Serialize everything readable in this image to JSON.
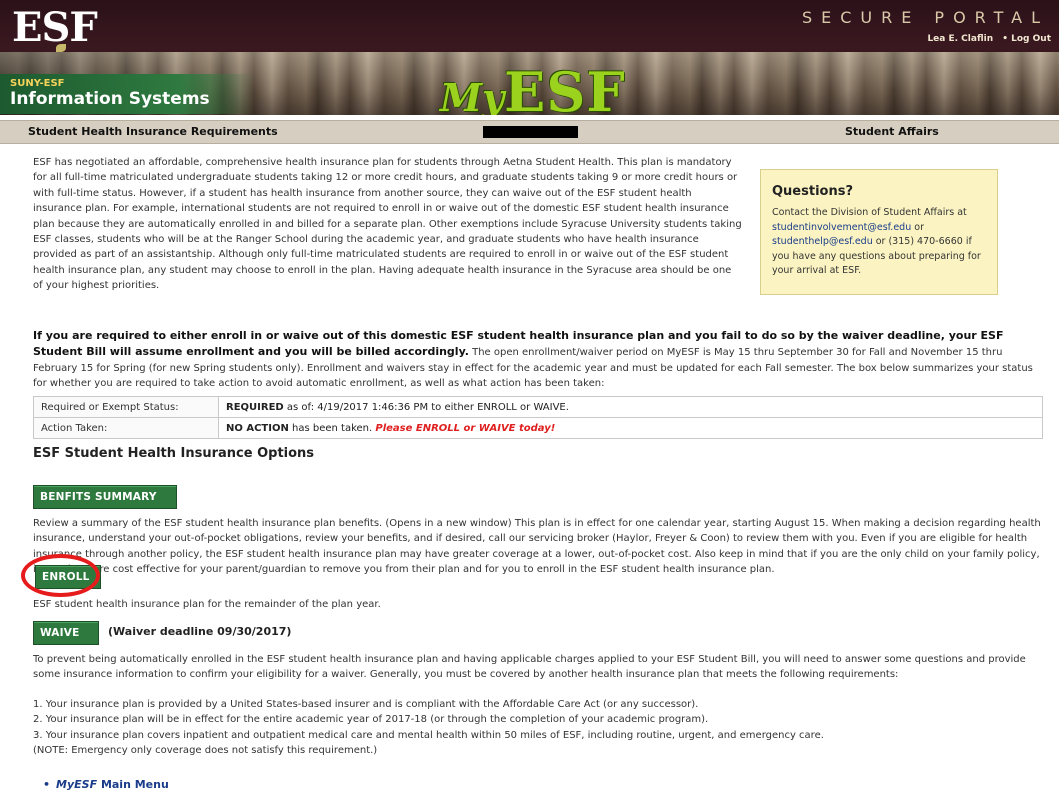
{
  "header": {
    "logo": "ESF",
    "secure_portal": "SECURE PORTAL",
    "user_name": "Lea E. Claflin",
    "logout": "Log Out",
    "suny_small": "SUNY-ESF",
    "suny_big": "Information Systems",
    "myesf_my": "My",
    "myesf_esf": "ESF"
  },
  "tanbar": {
    "left": "Student Health Insurance Requirements",
    "right": "Student Affairs"
  },
  "intro": "ESF has negotiated an affordable, comprehensive health insurance plan for students through Aetna Student Health. This plan is mandatory for all full-time matriculated undergraduate students taking 12 or more credit hours, and graduate students taking 9 or more credit hours or with full-time status. However, if a student has health insurance from another source, they can waive out of the ESF student health insurance plan. For example, international students are not required to enroll in or waive out of the domestic ESF student health insurance plan because they are automatically enrolled in and billed for a separate plan. Other exemptions include Syracuse University students taking ESF classes, students who will be at the Ranger School during the academic year, and graduate students who have health insurance provided as part of an assistantship. Although only full-time matriculated students are required to enroll in or waive out of the ESF student health insurance plan, any student may choose to enroll in the plan. Having adequate health insurance in the Syracuse area should be one of your highest priorities.",
  "questions": {
    "title": "Questions?",
    "line1": "Contact the Division of Student Affairs at",
    "email1": "studentinvolvement@esf.edu",
    "or": " or",
    "email2": "studenthelp@esf.edu",
    "phone": " or (315) 470-6660",
    "line2": "if you have any questions about preparing for your arrival at ESF."
  },
  "warning": {
    "bold": "If you are required to either enroll in or waive out of this domestic ESF student health insurance plan and you fail to do so by the waiver deadline, your ESF Student Bill will assume enrollment and you will be billed accordingly.",
    "normal": " The open enrollment/waiver period on MyESF is May 15 thru September 30 for Fall and November 15 thru February 15 for Spring (for new Spring students only). Enrollment and waivers stay in effect for the academic year and must be updated for each Fall semester. The box below summarizes your status for whether you are required to take action to avoid automatic enrollment, as well as what action has been taken:"
  },
  "status": {
    "row1_label": "Required or Exempt Status:",
    "row1_bold": "REQUIRED",
    "row1_rest": " as of: 4/19/2017 1:46:36 PM to either ENROLL or WAIVE.",
    "row2_label": "Action Taken:",
    "row2_bold": "NO ACTION",
    "row2_rest": " has been taken. ",
    "row2_red": "Please ENROLL or WAIVE today!"
  },
  "options_title": "ESF Student Health Insurance Options",
  "buttons": {
    "benefits": "BENFITS SUMMARY",
    "enroll": "ENROLL",
    "waive": "WAIVE"
  },
  "benefits_text": "Review a summary of the ESF student health insurance plan benefits. (Opens in a new window) This plan is in effect for one calendar year, starting August 15. When making a decision regarding health insurance, understand your out-of-pocket obligations, review your benefits, and if desired, call our servicing broker (Haylor, Freyer & Coon) to review them with you. Even if you are eligible for health insurance through another policy, the ESF student health insurance plan may have greater coverage at a lower, out-of-pocket cost. Also keep in mind that if you are the only child on your family policy, it may be more cost effective for your parent/guardian to remove you from their plan and for you to enroll in the ESF student health insurance plan.",
  "enroll_desc": "ESF student health insurance plan for the remainder of the plan year.",
  "waive_deadline": "(Waiver deadline 09/30/2017)",
  "waive_text": "To prevent being automatically enrolled in the ESF student health insurance plan and having applicable charges applied to your ESF Student Bill, you will need to answer some questions and provide some insurance information to confirm your eligibility for a waiver. Generally, you must be covered by another health insurance plan that meets the following requirements:",
  "requirements": [
    "1. Your insurance plan is provided by a United States-based insurer and is compliant with the Affordable Care Act (or any successor).",
    "2. Your insurance plan will be in effect for the entire academic year of 2017-18 (or through the completion of your academic program).",
    "3. Your insurance plan covers inpatient and outpatient medical care and mental health within 50 miles of ESF, including routine, urgent, and emergency care.",
    "(NOTE: Emergency only coverage does not satisfy this requirement.)"
  ],
  "menu_link": {
    "ital": "MyESF",
    "rest": " Main Menu"
  },
  "colors": {
    "button_green": "#2e7a3e",
    "annotation_red": "#e61b1b",
    "questions_bg": "#fbf4c2"
  }
}
